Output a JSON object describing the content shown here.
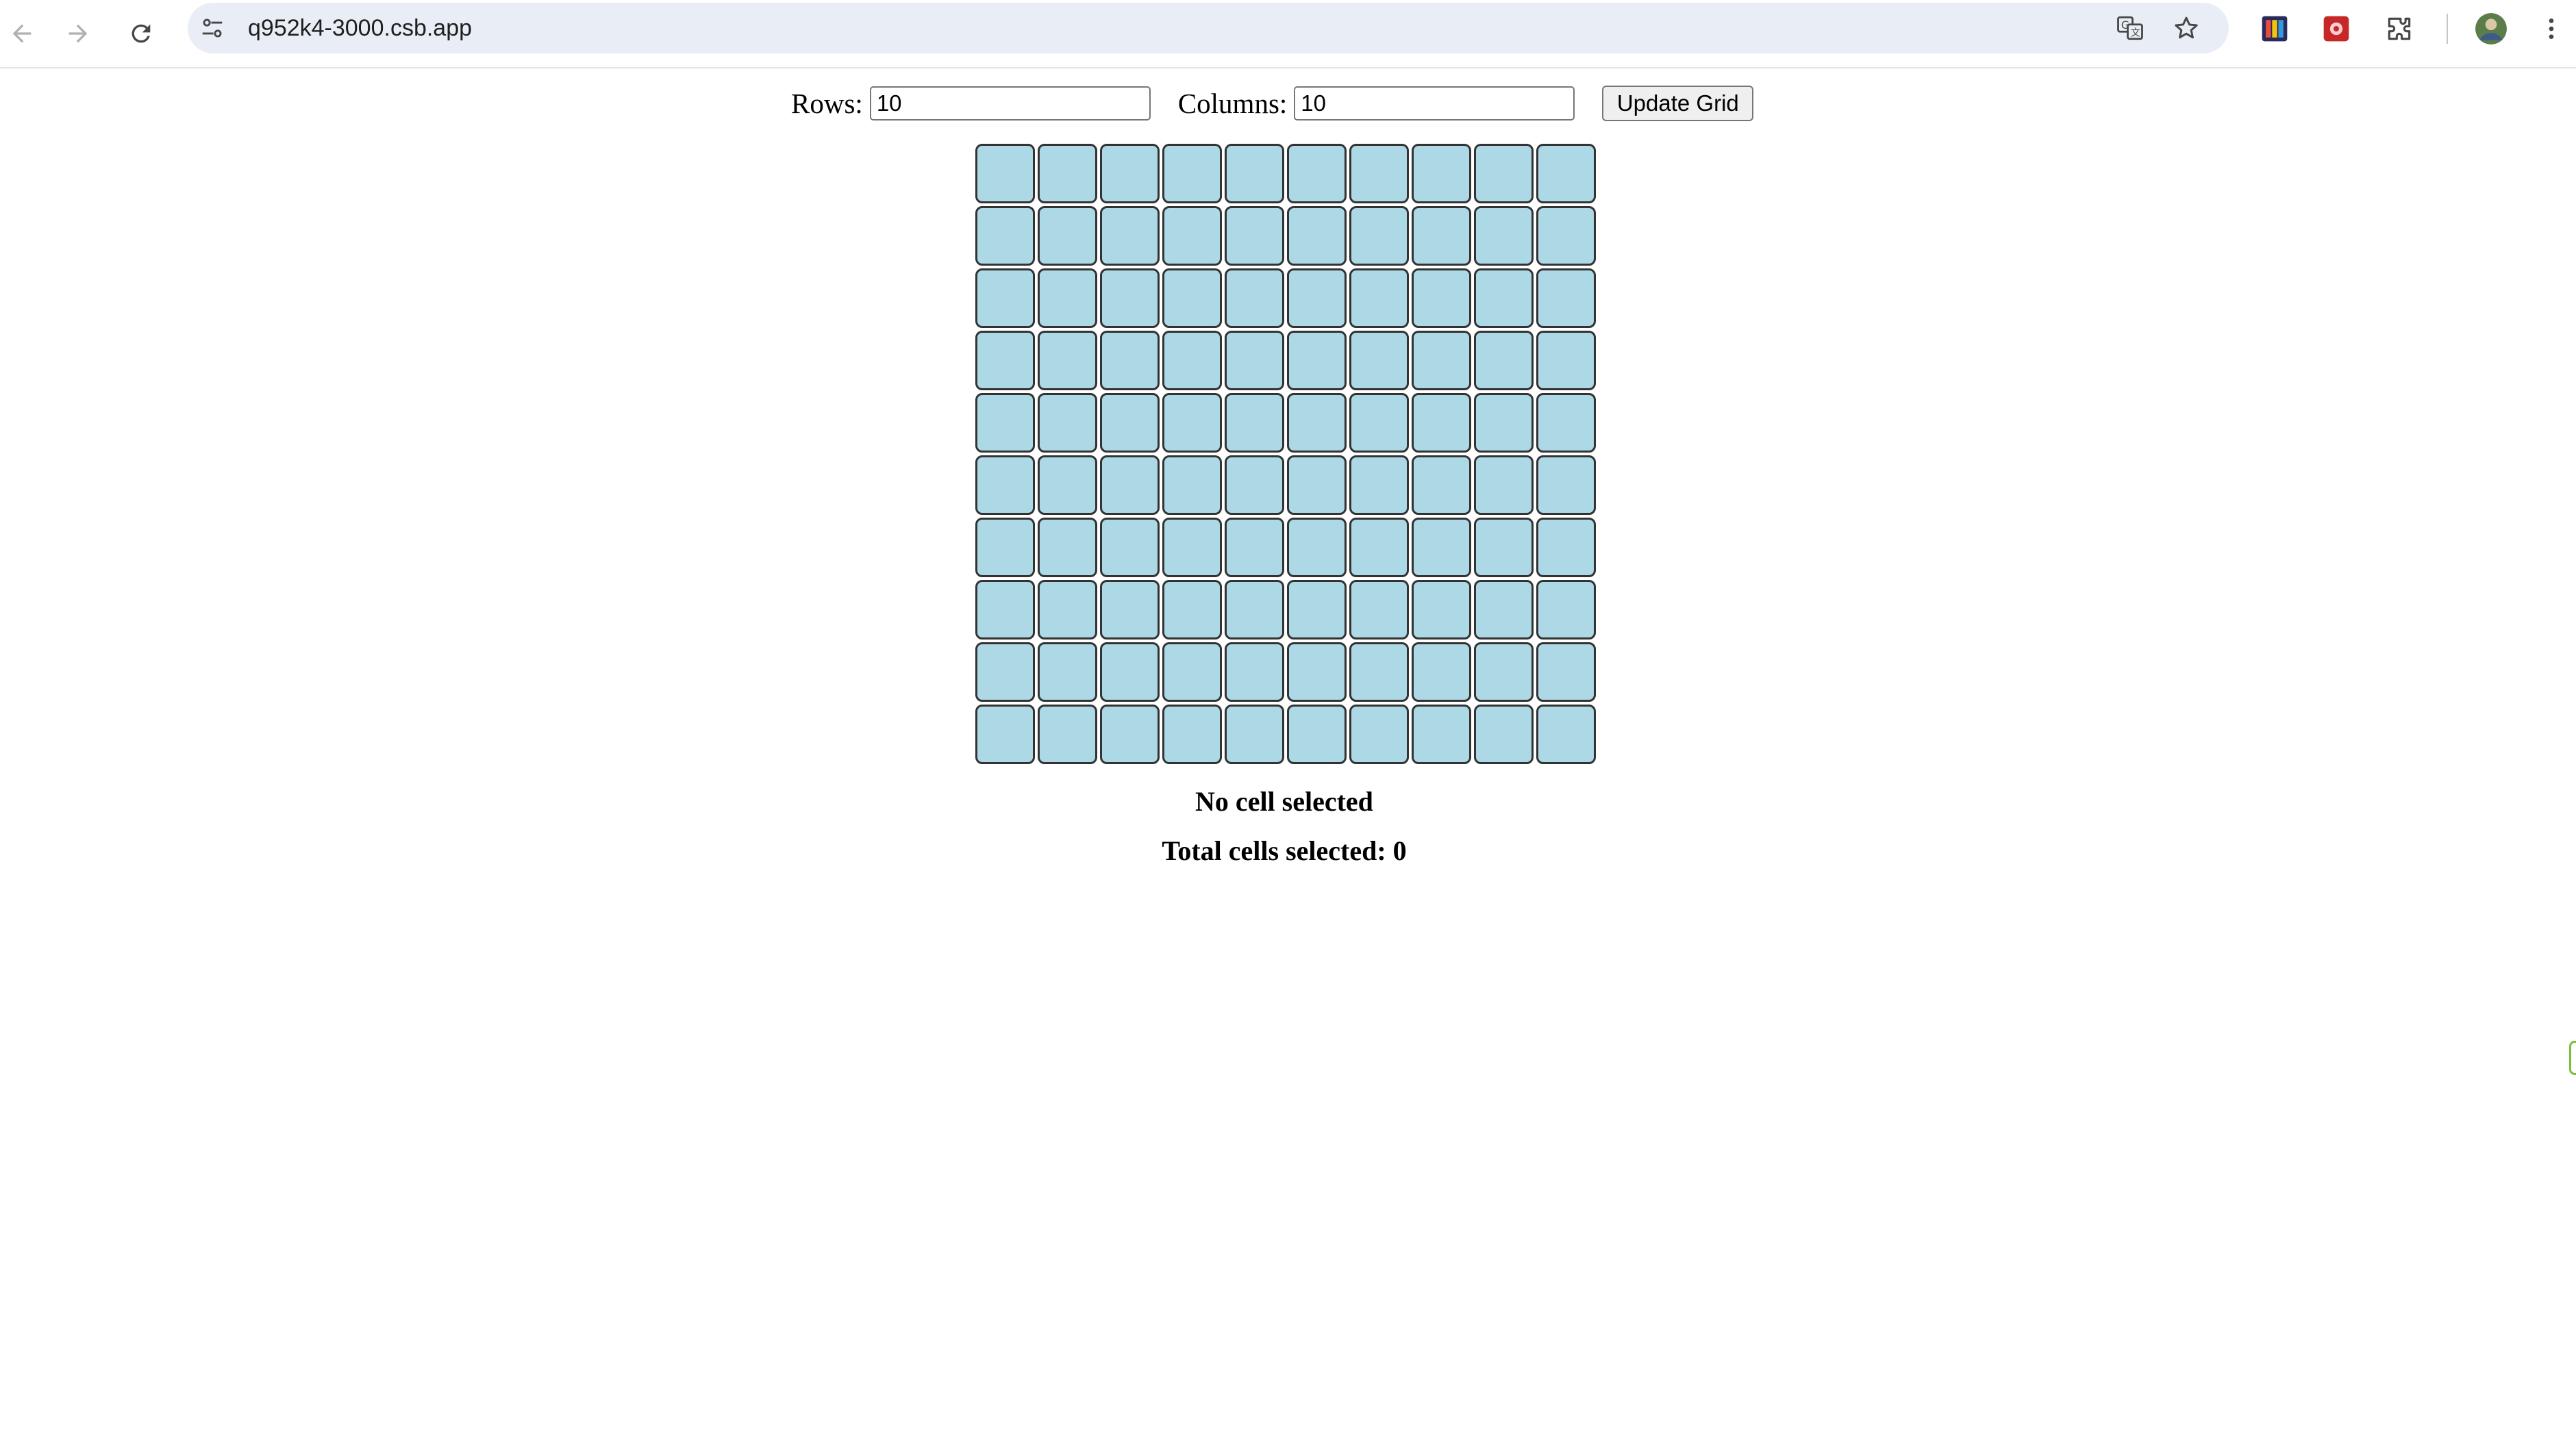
{
  "browser": {
    "url": "q952k4-3000.csb.app"
  },
  "controls": {
    "rows_label": "Rows:",
    "rows_value": "10",
    "columns_label": "Columns:",
    "columns_value": "10",
    "update_label": "Update Grid"
  },
  "grid": {
    "rows": 10,
    "columns": 10,
    "cell_color": "#add8e6",
    "border_color": "#333333"
  },
  "status": {
    "selection": "No cell selected",
    "total": "Total cells selected: 0"
  }
}
